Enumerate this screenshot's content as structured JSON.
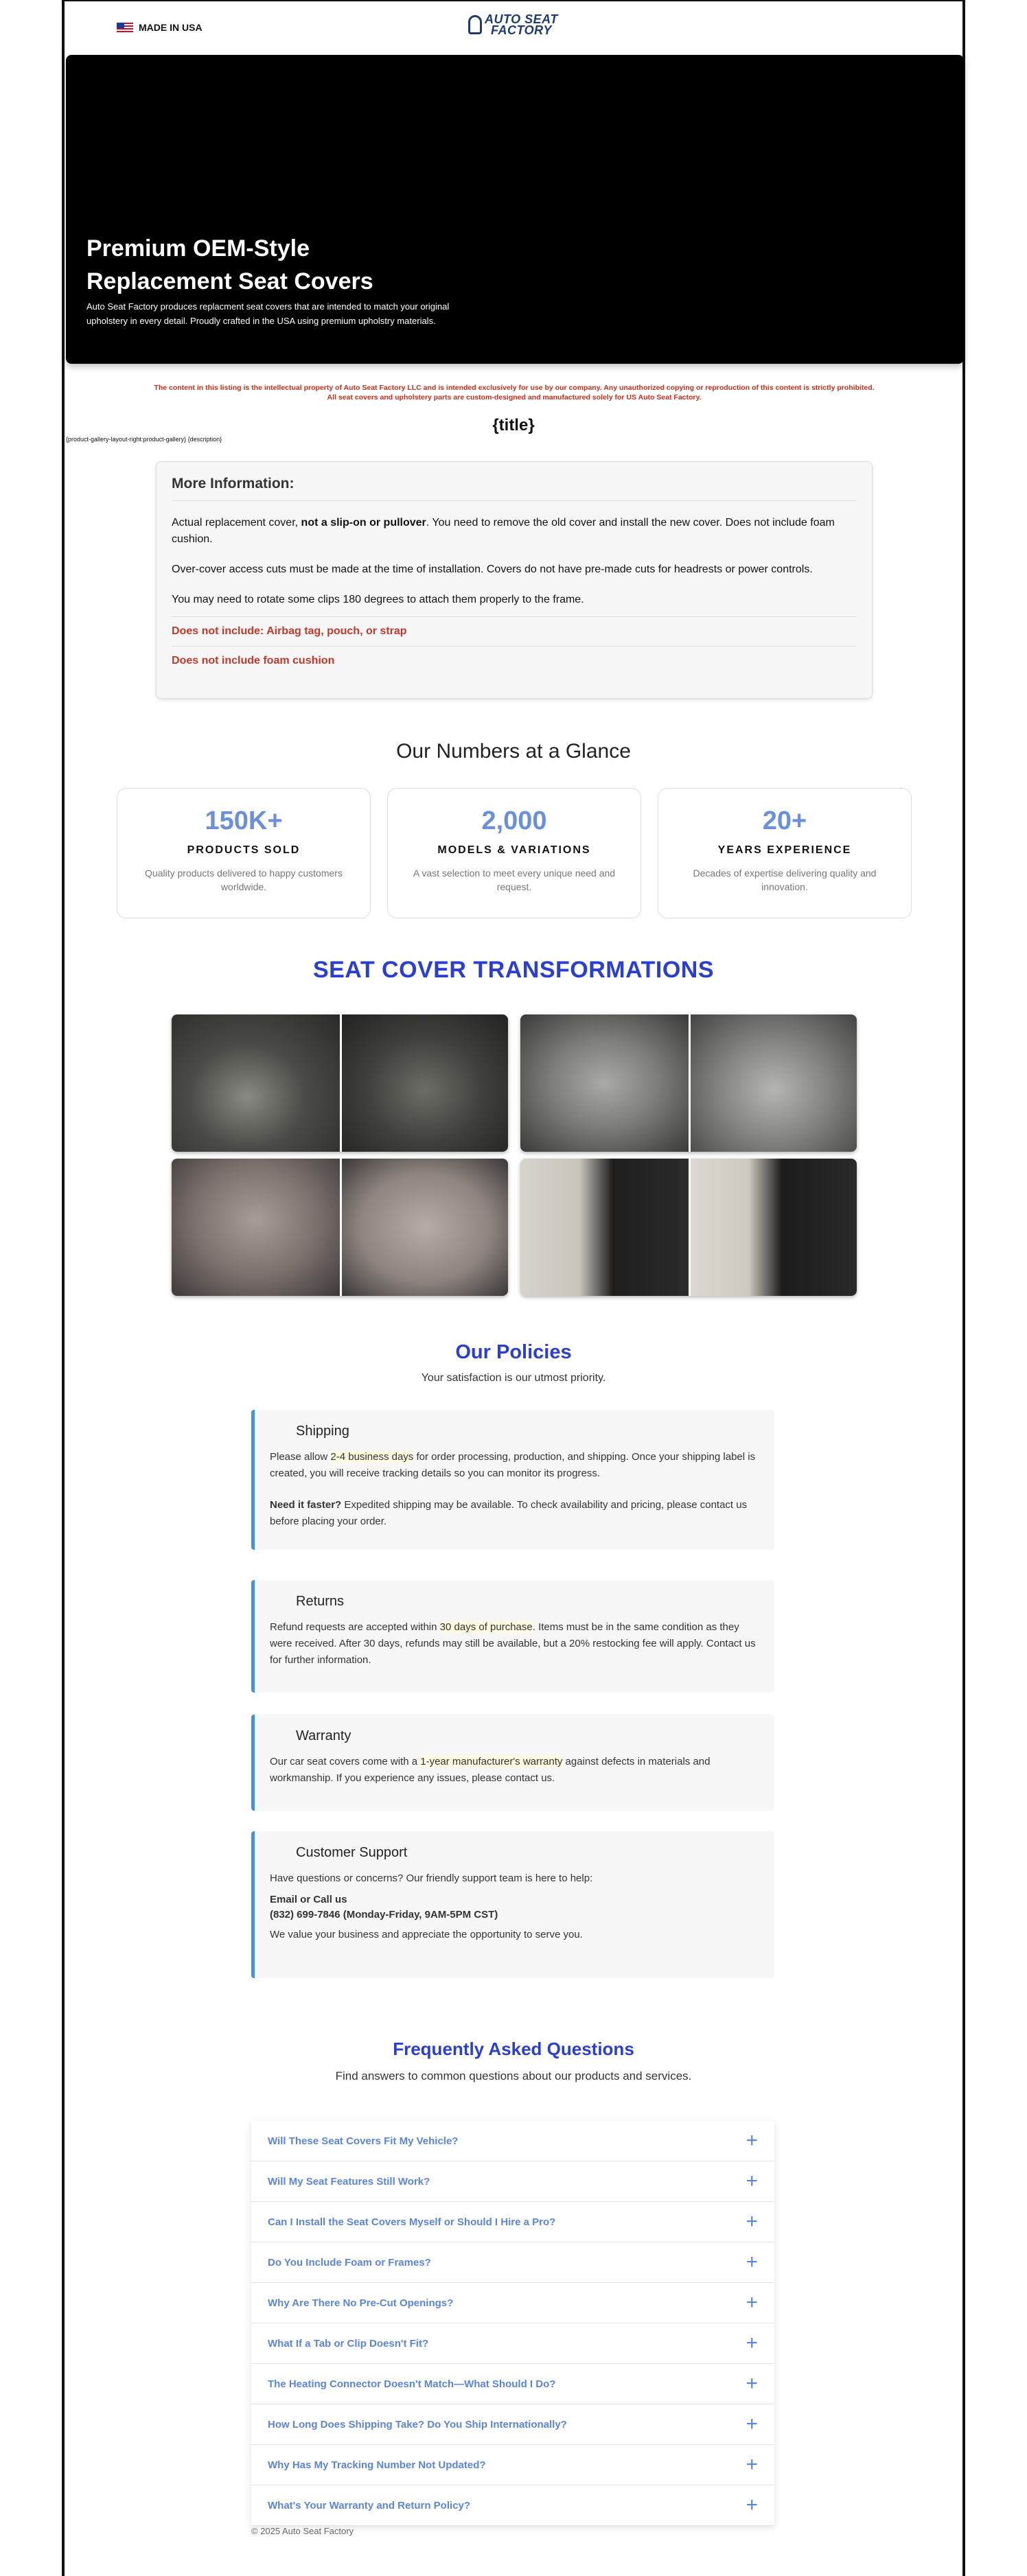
{
  "header": {
    "made_in": "MADE IN USA",
    "logo_line1": "AUTO SEAT",
    "logo_line2": "FACTORY"
  },
  "hero": {
    "title": "Premium OEM-Style Replacement Seat Covers",
    "desc": "Auto Seat Factory produces replacment seat covers that are intended to match your original upholstery in every detail. Proudly crafted in the USA using premium upholstry materials."
  },
  "notice": "The content in this listing is the intellectual property of Auto Seat Factory LLC and is intended exclusively for use by our company. Any unauthorized copying or reproduction of this content is strictly prohibited. All seat covers and upholstery parts are custom-designed and manufactured solely for US Auto Seat Factory.",
  "product_title": "{title}",
  "placeholder": "{product-gallery-layout-right:product-gallery} {description}",
  "more_info": {
    "heading": "More Information:",
    "p1_a": "Actual replacement cover, ",
    "p1_b": "not a slip-on or pullover",
    "p1_c": ". You need to remove the old cover and install the new cover. Does not include foam cushion.",
    "p2": "Over-cover access cuts must be made at the time of installation. Covers do not have pre-made cuts for headrests or power controls.",
    "p3": "You may need to rotate some clips 180 degrees to attach them properly to the frame.",
    "w1": "Does not include: Airbag tag, pouch, or strap",
    "w2": "Does not include foam cushion"
  },
  "numbers": {
    "title": "Our Numbers at a Glance",
    "stats": [
      {
        "value": "150K+",
        "label": "PRODUCTS SOLD",
        "desc": "Quality products delivered to happy customers worldwide."
      },
      {
        "value": "2,000",
        "label": "MODELS & VARIATIONS",
        "desc": "A vast selection to meet every unique need and request."
      },
      {
        "value": "20+",
        "label": "YEARS EXPERIENCE",
        "desc": "Decades of expertise delivering quality and innovation."
      }
    ]
  },
  "transformations": {
    "title": "SEAT COVER TRANSFORMATIONS"
  },
  "policies": {
    "title": "Our Policies",
    "subtitle": "Your satisfaction is our utmost priority.",
    "shipping": {
      "title": "Shipping",
      "p1_a": "Please allow ",
      "p1_hl": "2-4 business days",
      "p1_b": " for order processing, production, and shipping. Once your shipping label is created, you will receive tracking details so you can monitor its progress.",
      "p2_bold": "Need it faster?",
      "p2_rest": " Expedited shipping may be available. To check availability and pricing, please contact us before placing your order."
    },
    "returns": {
      "title": "Returns",
      "p_a": "Refund requests are accepted within ",
      "p_hl": "30 days of purchase",
      "p_b": ". Items must be in the same condition as they were received. After 30 days, refunds may still be available, but a 20% restocking fee will apply. Contact us for further information."
    },
    "warranty": {
      "title": "Warranty",
      "p_a": "Our car seat covers come with a ",
      "p_hl": "1-year manufacturer's warranty",
      "p_b": " against defects in materials and workmanship. If you experience any issues, please contact us."
    },
    "support": {
      "title": "Customer Support",
      "p1": "Have questions or concerns? Our friendly support team is here to help:",
      "email": "Email or Call us",
      "phone": "(832) 699-7846 (Monday-Friday, 9AM-5PM CST)",
      "p2": "We value your business and appreciate the opportunity to serve you."
    }
  },
  "faq": {
    "title": "Frequently Asked Questions",
    "subtitle": "Find answers to common questions about our products and services.",
    "items": [
      "Will These Seat Covers Fit My Vehicle?",
      "Will My Seat Features Still Work?",
      "Can I Install the Seat Covers Myself or Should I Hire a Pro?",
      "Do You Include Foam or Frames?",
      "Why Are There No Pre-Cut Openings?",
      "What If a Tab or Clip Doesn't Fit?",
      "The Heating Connector Doesn't Match—What Should I Do?",
      "How Long Does Shipping Take? Do You Ship Internationally?",
      "Why Has My Tracking Number Not Updated?",
      "What's Your Warranty and Return Policy?"
    ]
  },
  "footer": "© 2025 Auto Seat Factory"
}
